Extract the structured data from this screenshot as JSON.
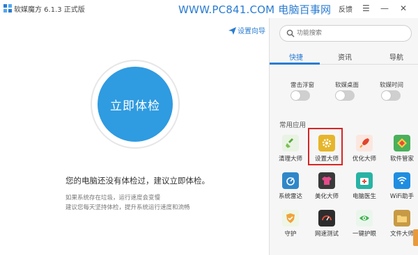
{
  "titlebar": {
    "title": "软媒魔方 6.1.3 正式版",
    "watermark": "WWW.PC841.COM 电脑百事网",
    "feedback": "反馈"
  },
  "main": {
    "setup_guide": "设置向导",
    "check_button": "立即体检",
    "status": "您的电脑还没有体检过，建议立即体检。",
    "hint_line1": "如果系统存在垃圾，运行速度会变慢",
    "hint_line2": "建议您每天坚持体检，提升系统运行速度和流畅"
  },
  "right": {
    "search_placeholder": "功能搜索",
    "tabs": [
      "快捷",
      "资讯",
      "导航"
    ],
    "toggles": [
      {
        "label": "雷击浮窗",
        "on": false
      },
      {
        "label": "软媒桌面",
        "on": false
      },
      {
        "label": "软媒时间",
        "on": false
      }
    ],
    "section_title": "常用应用",
    "apps": [
      {
        "label": "清理大师",
        "icon": "broom-icon",
        "color": "#e9f3e4"
      },
      {
        "label": "设置大师",
        "icon": "gear-icon",
        "color": "#e6b52a"
      },
      {
        "label": "优化大师",
        "icon": "rocket-icon",
        "color": "#fbe7df"
      },
      {
        "label": "软件管家",
        "icon": "box-icon",
        "color": "#4bb05a"
      },
      {
        "label": "系统雷达",
        "icon": "radar-icon",
        "color": "#2f87c9"
      },
      {
        "label": "美化大师",
        "icon": "tshirt-icon",
        "color": "#3a3a3a"
      },
      {
        "label": "电脑医生",
        "icon": "medkit-icon",
        "color": "#28b3a4"
      },
      {
        "label": "WiFi助手",
        "icon": "wifi-icon",
        "color": "#1f8ee0"
      },
      {
        "label": "守护",
        "icon": "shield-icon",
        "color": "#eef6e6"
      },
      {
        "label": "网速测试",
        "icon": "speedometer-icon",
        "color": "#2d2d2d"
      },
      {
        "label": "一键护眼",
        "icon": "eye-icon",
        "color": "#eaf6ec"
      },
      {
        "label": "文件大师",
        "icon": "folder-icon",
        "color": "#c79a45"
      }
    ]
  },
  "colors": {
    "accent": "#2a7cd2",
    "check_button": "#2f9be0",
    "highlight": "#d62525"
  }
}
